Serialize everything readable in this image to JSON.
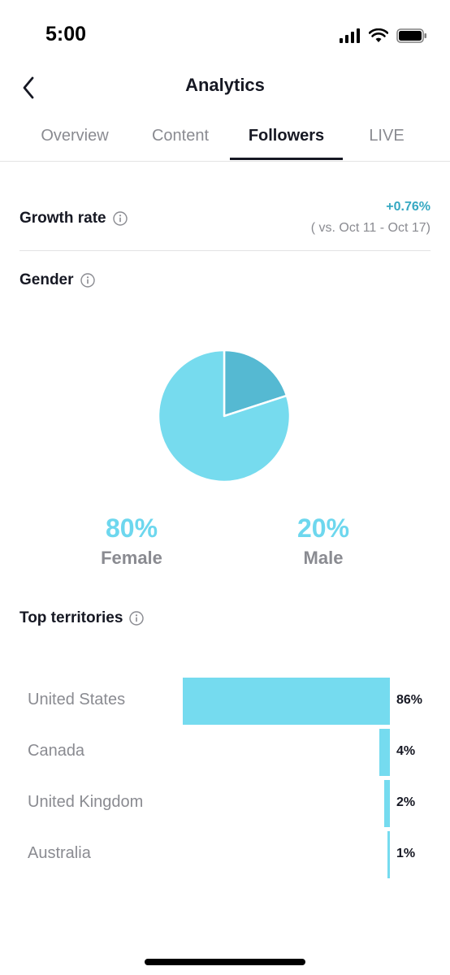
{
  "status_bar": {
    "time": "5:00"
  },
  "header": {
    "title": "Analytics"
  },
  "tabs": [
    {
      "label": "Overview",
      "active": false
    },
    {
      "label": "Content",
      "active": false
    },
    {
      "label": "Followers",
      "active": true
    },
    {
      "label": "LIVE",
      "active": false
    }
  ],
  "growth": {
    "title": "Growth rate",
    "value": "+0.76%",
    "compare": "( vs. Oct 11 - Oct 17)"
  },
  "gender": {
    "title": "Gender",
    "female_pct": "80%",
    "female_label": "Female",
    "male_pct": "20%",
    "male_label": "Male"
  },
  "chart_data": {
    "type": "pie",
    "categories": [
      "Female",
      "Male"
    ],
    "values": [
      80,
      20
    ],
    "colors": [
      "#76dbee",
      "#55b9d2"
    ]
  },
  "territories": {
    "title": "Top territories",
    "items": [
      {
        "name": "United States",
        "percent": 86,
        "label": "86%"
      },
      {
        "name": "Canada",
        "percent": 4,
        "label": "4%"
      },
      {
        "name": "United Kingdom",
        "percent": 2,
        "label": "2%"
      },
      {
        "name": "Australia",
        "percent": 1,
        "label": "1%"
      }
    ]
  },
  "colors": {
    "accent": "#35a8c2",
    "bar": "#75dbef",
    "text": "#161823",
    "muted": "#8a8b91"
  },
  "icons": [
    "back-chevron-icon",
    "info-icon",
    "signal-icon",
    "wifi-icon",
    "battery-icon"
  ]
}
